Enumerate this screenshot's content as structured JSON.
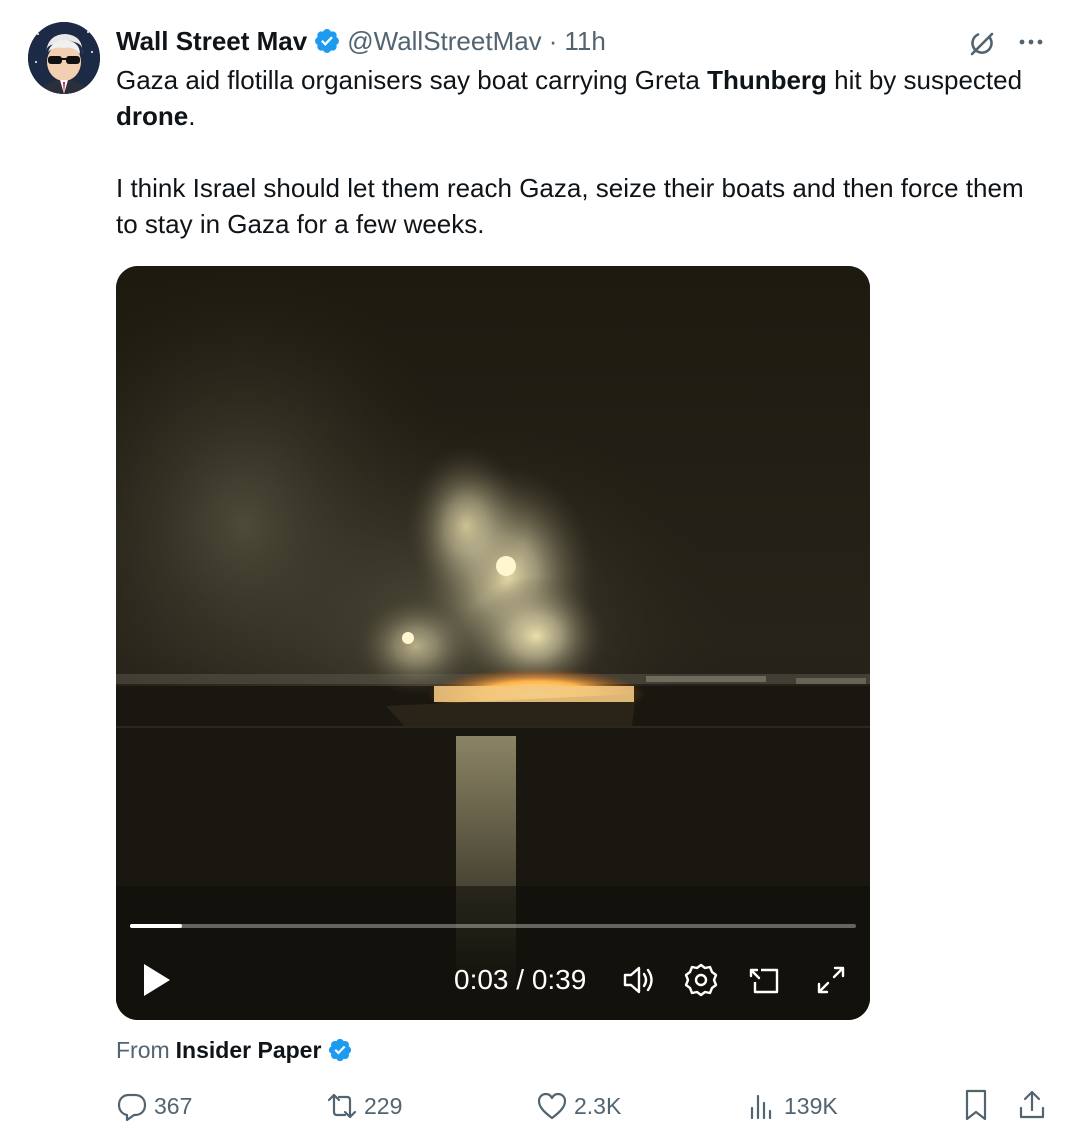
{
  "author": {
    "display_name": "Wall Street Mav",
    "handle": "@WallStreetMav",
    "separator": "·",
    "time": "11h",
    "avatar_icon": "wall-street-mav-avatar",
    "verified_color": "#1d9bf0"
  },
  "tweet": {
    "para1": {
      "part1": "Gaza aid flotilla organisers say boat carrying Greta ",
      "bold1": "Thunberg",
      "part2": " hit by suspected ",
      "bold2": "drone",
      "part3": "."
    },
    "para2": "I think Israel should let them reach Gaza, seize their boats and then force them to stay in Gaza for a few weeks."
  },
  "video": {
    "time_readout": "0:03 / 0:39",
    "progress": 0.072,
    "icons": [
      "play-icon",
      "volume-icon",
      "settings-icon",
      "pip-icon",
      "fullscreen-icon"
    ]
  },
  "source": {
    "prefix": "From",
    "name": "Insider Paper"
  },
  "actions": {
    "replies": "367",
    "reposts": "229",
    "likes": "2.3K",
    "views": "139K"
  },
  "colors": {
    "text": "#0f1419",
    "secondary": "#536471",
    "accent": "#1d9bf0"
  }
}
